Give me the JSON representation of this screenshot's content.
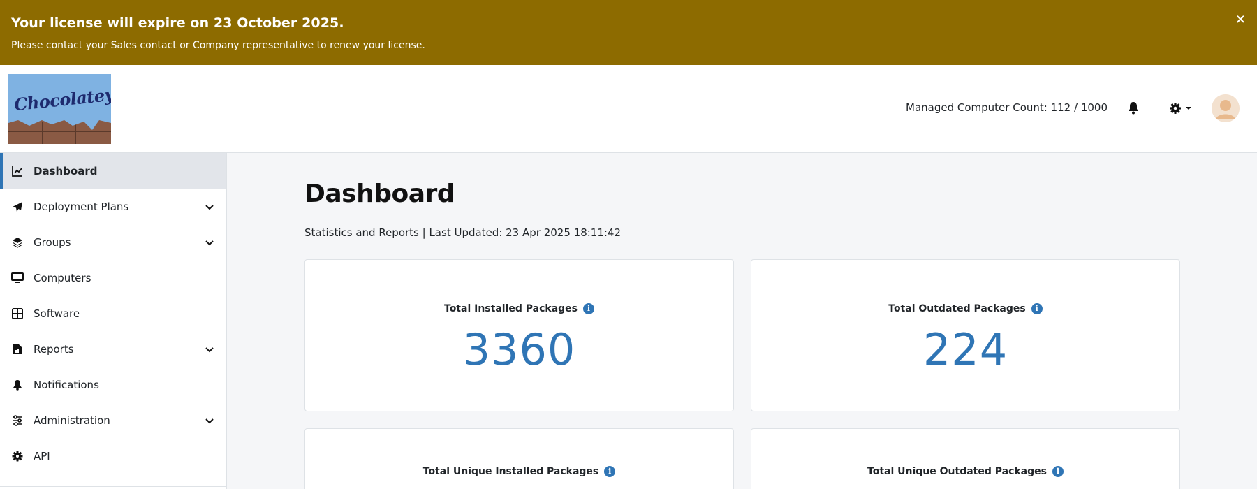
{
  "banner": {
    "title": "Your license will expire on 23 October 2025.",
    "text": "Please contact your Sales contact or Company representative to renew your license.",
    "close_label": "×"
  },
  "header": {
    "logo_text": "Chocolatey",
    "managed_computer_count": "Managed Computer Count: 112 / 1000",
    "icons": [
      "bell-icon",
      "gear-icon",
      "chevron-down-icon",
      "avatar"
    ]
  },
  "sidebar": {
    "items": [
      {
        "label": "Dashboard",
        "icon": "chart-line-icon",
        "expandable": false,
        "active": true
      },
      {
        "label": "Deployment Plans",
        "icon": "paper-plane-icon",
        "expandable": true
      },
      {
        "label": "Groups",
        "icon": "layers-icon",
        "expandable": true
      },
      {
        "label": "Computers",
        "icon": "desktop-icon",
        "expandable": false
      },
      {
        "label": "Software",
        "icon": "grid-icon",
        "expandable": false
      },
      {
        "label": "Reports",
        "icon": "report-icon",
        "expandable": true
      },
      {
        "label": "Notifications",
        "icon": "bell-icon",
        "expandable": false
      },
      {
        "label": "Administration",
        "icon": "sliders-icon",
        "expandable": true
      },
      {
        "label": "API",
        "icon": "gear-icon",
        "expandable": false
      }
    ]
  },
  "main": {
    "title": "Dashboard",
    "subtitle": "Statistics and Reports | Last Updated: 23 Apr 2025 18:11:42",
    "cards": [
      {
        "title": "Total Installed Packages",
        "value": "3360"
      },
      {
        "title": "Total Outdated Packages",
        "value": "224"
      },
      {
        "title": "Total Unique Installed Packages",
        "value": ""
      },
      {
        "title": "Total Unique Outdated Packages",
        "value": ""
      }
    ]
  },
  "colors": {
    "banner_bg": "#8d6b00",
    "accent": "#2f75b5",
    "active_nav_bg": "#e2e5ea"
  }
}
